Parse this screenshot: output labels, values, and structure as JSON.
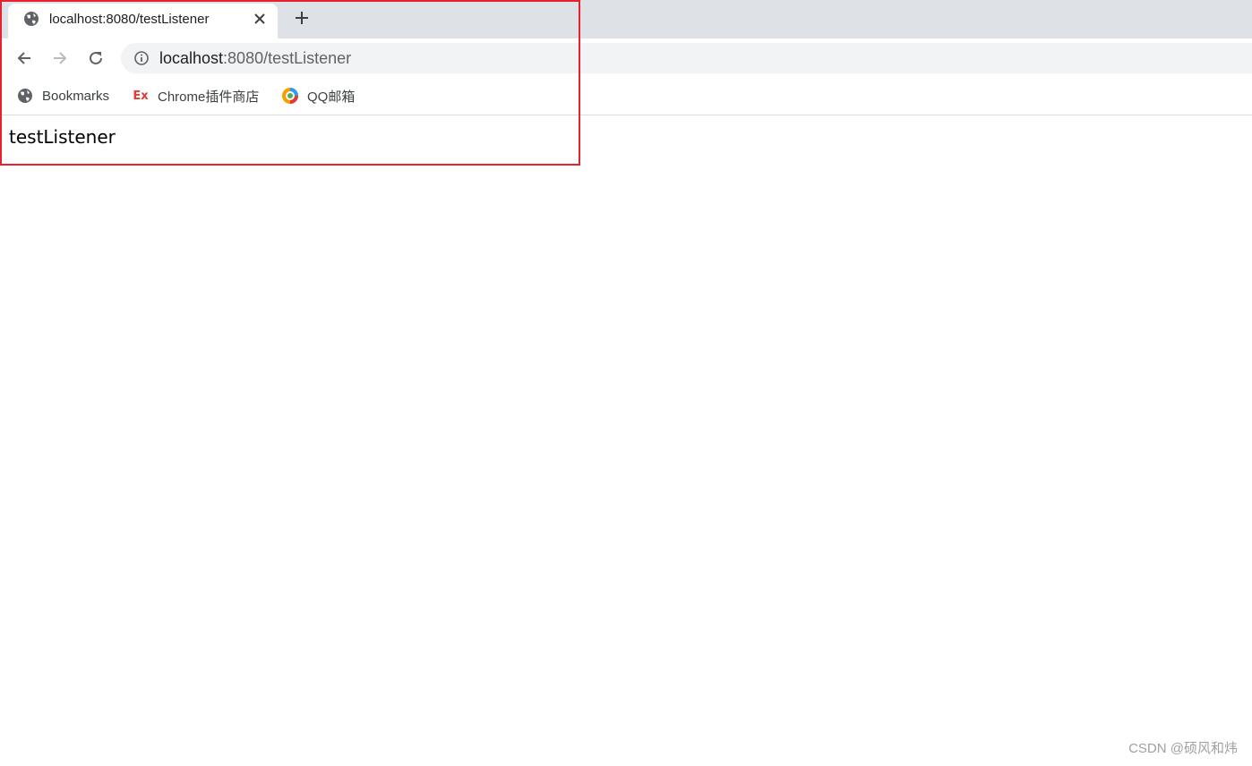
{
  "tab": {
    "title": "localhost:8080/testListener"
  },
  "omnibox": {
    "host": "localhost",
    "rest": ":8080/testListener"
  },
  "bookmarks": [
    {
      "label": "Bookmarks",
      "icon": "globe-icon"
    },
    {
      "label": "Chrome插件商店",
      "icon": "ex-extension-icon"
    },
    {
      "label": "QQ邮箱",
      "icon": "qq-mail-icon"
    }
  ],
  "page": {
    "content": "testListener"
  },
  "watermark": "CSDN @硕风和炜",
  "colors": {
    "highlight": "#e8212e",
    "tabstrip": "#dee1e6",
    "omnibox": "#f1f3f4"
  }
}
